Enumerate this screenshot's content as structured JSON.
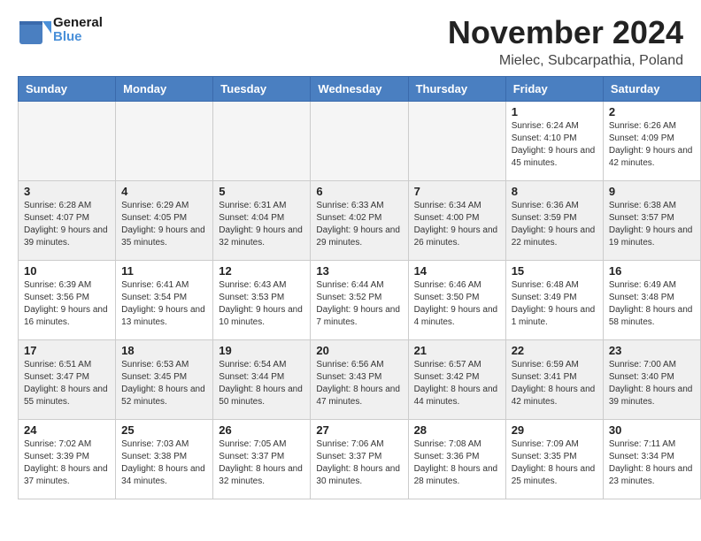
{
  "header": {
    "logo_text_general": "General",
    "logo_text_blue": "Blue",
    "month_title": "November 2024",
    "subtitle": "Mielec, Subcarpathia, Poland"
  },
  "calendar": {
    "days_of_week": [
      "Sunday",
      "Monday",
      "Tuesday",
      "Wednesday",
      "Thursday",
      "Friday",
      "Saturday"
    ],
    "weeks": [
      [
        {
          "day": "",
          "empty": true
        },
        {
          "day": "",
          "empty": true
        },
        {
          "day": "",
          "empty": true
        },
        {
          "day": "",
          "empty": true
        },
        {
          "day": "",
          "empty": true
        },
        {
          "day": "1",
          "sunrise": "Sunrise: 6:24 AM",
          "sunset": "Sunset: 4:10 PM",
          "daylight": "Daylight: 9 hours and 45 minutes."
        },
        {
          "day": "2",
          "sunrise": "Sunrise: 6:26 AM",
          "sunset": "Sunset: 4:09 PM",
          "daylight": "Daylight: 9 hours and 42 minutes."
        }
      ],
      [
        {
          "day": "3",
          "sunrise": "Sunrise: 6:28 AM",
          "sunset": "Sunset: 4:07 PM",
          "daylight": "Daylight: 9 hours and 39 minutes."
        },
        {
          "day": "4",
          "sunrise": "Sunrise: 6:29 AM",
          "sunset": "Sunset: 4:05 PM",
          "daylight": "Daylight: 9 hours and 35 minutes."
        },
        {
          "day": "5",
          "sunrise": "Sunrise: 6:31 AM",
          "sunset": "Sunset: 4:04 PM",
          "daylight": "Daylight: 9 hours and 32 minutes."
        },
        {
          "day": "6",
          "sunrise": "Sunrise: 6:33 AM",
          "sunset": "Sunset: 4:02 PM",
          "daylight": "Daylight: 9 hours and 29 minutes."
        },
        {
          "day": "7",
          "sunrise": "Sunrise: 6:34 AM",
          "sunset": "Sunset: 4:00 PM",
          "daylight": "Daylight: 9 hours and 26 minutes."
        },
        {
          "day": "8",
          "sunrise": "Sunrise: 6:36 AM",
          "sunset": "Sunset: 3:59 PM",
          "daylight": "Daylight: 9 hours and 22 minutes."
        },
        {
          "day": "9",
          "sunrise": "Sunrise: 6:38 AM",
          "sunset": "Sunset: 3:57 PM",
          "daylight": "Daylight: 9 hours and 19 minutes."
        }
      ],
      [
        {
          "day": "10",
          "sunrise": "Sunrise: 6:39 AM",
          "sunset": "Sunset: 3:56 PM",
          "daylight": "Daylight: 9 hours and 16 minutes."
        },
        {
          "day": "11",
          "sunrise": "Sunrise: 6:41 AM",
          "sunset": "Sunset: 3:54 PM",
          "daylight": "Daylight: 9 hours and 13 minutes."
        },
        {
          "day": "12",
          "sunrise": "Sunrise: 6:43 AM",
          "sunset": "Sunset: 3:53 PM",
          "daylight": "Daylight: 9 hours and 10 minutes."
        },
        {
          "day": "13",
          "sunrise": "Sunrise: 6:44 AM",
          "sunset": "Sunset: 3:52 PM",
          "daylight": "Daylight: 9 hours and 7 minutes."
        },
        {
          "day": "14",
          "sunrise": "Sunrise: 6:46 AM",
          "sunset": "Sunset: 3:50 PM",
          "daylight": "Daylight: 9 hours and 4 minutes."
        },
        {
          "day": "15",
          "sunrise": "Sunrise: 6:48 AM",
          "sunset": "Sunset: 3:49 PM",
          "daylight": "Daylight: 9 hours and 1 minute."
        },
        {
          "day": "16",
          "sunrise": "Sunrise: 6:49 AM",
          "sunset": "Sunset: 3:48 PM",
          "daylight": "Daylight: 8 hours and 58 minutes."
        }
      ],
      [
        {
          "day": "17",
          "sunrise": "Sunrise: 6:51 AM",
          "sunset": "Sunset: 3:47 PM",
          "daylight": "Daylight: 8 hours and 55 minutes."
        },
        {
          "day": "18",
          "sunrise": "Sunrise: 6:53 AM",
          "sunset": "Sunset: 3:45 PM",
          "daylight": "Daylight: 8 hours and 52 minutes."
        },
        {
          "day": "19",
          "sunrise": "Sunrise: 6:54 AM",
          "sunset": "Sunset: 3:44 PM",
          "daylight": "Daylight: 8 hours and 50 minutes."
        },
        {
          "day": "20",
          "sunrise": "Sunrise: 6:56 AM",
          "sunset": "Sunset: 3:43 PM",
          "daylight": "Daylight: 8 hours and 47 minutes."
        },
        {
          "day": "21",
          "sunrise": "Sunrise: 6:57 AM",
          "sunset": "Sunset: 3:42 PM",
          "daylight": "Daylight: 8 hours and 44 minutes."
        },
        {
          "day": "22",
          "sunrise": "Sunrise: 6:59 AM",
          "sunset": "Sunset: 3:41 PM",
          "daylight": "Daylight: 8 hours and 42 minutes."
        },
        {
          "day": "23",
          "sunrise": "Sunrise: 7:00 AM",
          "sunset": "Sunset: 3:40 PM",
          "daylight": "Daylight: 8 hours and 39 minutes."
        }
      ],
      [
        {
          "day": "24",
          "sunrise": "Sunrise: 7:02 AM",
          "sunset": "Sunset: 3:39 PM",
          "daylight": "Daylight: 8 hours and 37 minutes."
        },
        {
          "day": "25",
          "sunrise": "Sunrise: 7:03 AM",
          "sunset": "Sunset: 3:38 PM",
          "daylight": "Daylight: 8 hours and 34 minutes."
        },
        {
          "day": "26",
          "sunrise": "Sunrise: 7:05 AM",
          "sunset": "Sunset: 3:37 PM",
          "daylight": "Daylight: 8 hours and 32 minutes."
        },
        {
          "day": "27",
          "sunrise": "Sunrise: 7:06 AM",
          "sunset": "Sunset: 3:37 PM",
          "daylight": "Daylight: 8 hours and 30 minutes."
        },
        {
          "day": "28",
          "sunrise": "Sunrise: 7:08 AM",
          "sunset": "Sunset: 3:36 PM",
          "daylight": "Daylight: 8 hours and 28 minutes."
        },
        {
          "day": "29",
          "sunrise": "Sunrise: 7:09 AM",
          "sunset": "Sunset: 3:35 PM",
          "daylight": "Daylight: 8 hours and 25 minutes."
        },
        {
          "day": "30",
          "sunrise": "Sunrise: 7:11 AM",
          "sunset": "Sunset: 3:34 PM",
          "daylight": "Daylight: 8 hours and 23 minutes."
        }
      ]
    ]
  }
}
